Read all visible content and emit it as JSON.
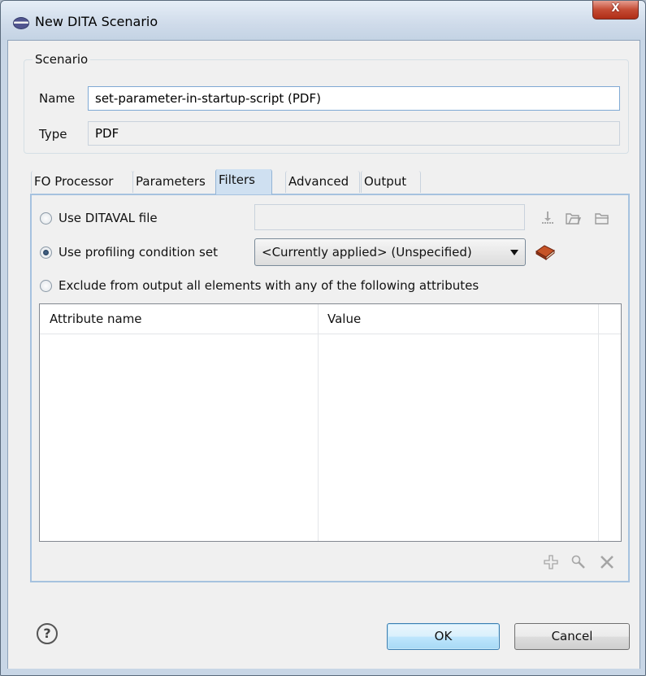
{
  "window": {
    "title": "New DITA Scenario",
    "close_glyph": "X"
  },
  "scenario": {
    "legend": "Scenario",
    "name_label": "Name",
    "name_value": "set-parameter-in-startup-script (PDF)",
    "type_label": "Type",
    "type_value": "PDF"
  },
  "tabs": [
    {
      "label": "FO Processor"
    },
    {
      "label": "Parameters"
    },
    {
      "label": "Filters"
    },
    {
      "label": "Advanced"
    },
    {
      "label": "Output"
    }
  ],
  "active_tab": "Filters",
  "filters": {
    "ditaval_label": "Use DITAVAL file",
    "ditaval_value": "",
    "profiling_label": "Use profiling condition set",
    "profiling_selected": "<Currently applied> (Unspecified)",
    "exclude_label": "Exclude from output all elements with any of the following attributes",
    "selected_option": "profiling",
    "table": {
      "columns": [
        "Attribute name",
        "Value"
      ],
      "rows": []
    }
  },
  "icons": {
    "ditaval_tools": [
      "download-icon",
      "open-url-icon",
      "browse-folder-icon"
    ],
    "profiling_tool": "book-icon",
    "table_tools": [
      "add-icon",
      "edit-icon",
      "delete-icon"
    ],
    "help": "help-icon"
  },
  "buttons": {
    "ok": "OK",
    "cancel": "Cancel",
    "help_glyph": "?"
  },
  "colors": {
    "accent_border": "#a6c2df",
    "active_tab": "#cfe0f1",
    "close_button": "#c44b34",
    "book": "#b3421e"
  }
}
